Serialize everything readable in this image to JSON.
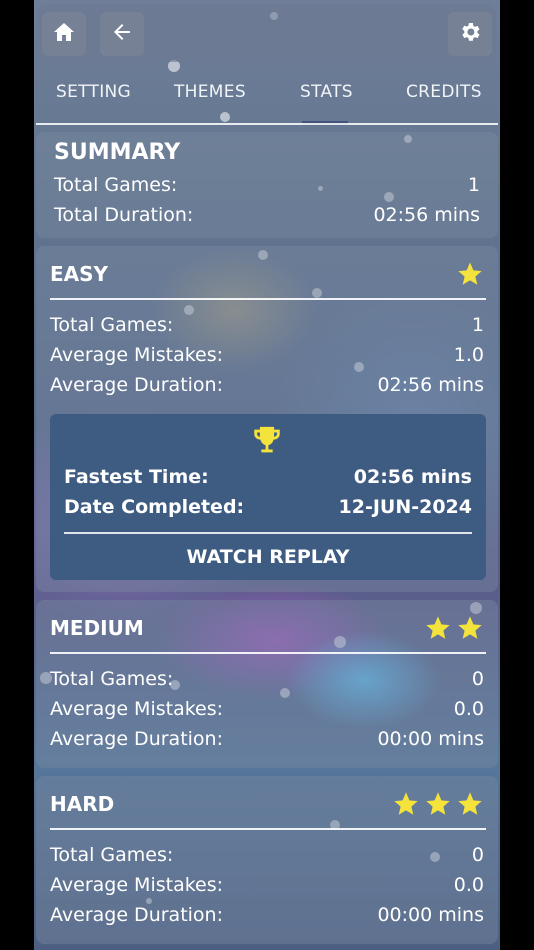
{
  "nav": {
    "home_icon": "home-icon",
    "back_icon": "back-arrow-icon",
    "settings_icon": "gear-icon"
  },
  "tabs": [
    {
      "label": "SETTINGS"
    },
    {
      "label": "THEMES"
    },
    {
      "label": "STATS",
      "active": true
    },
    {
      "label": "CREDITS"
    }
  ],
  "summary": {
    "title": "SUMMARY",
    "total_games_label": "Total Games:",
    "total_games_value": "1",
    "total_duration_label": "Total Duration:",
    "total_duration_value": "02:56 mins"
  },
  "easy": {
    "title": "EASY",
    "stars": 1,
    "total_games_label": "Total Games:",
    "total_games_value": "1",
    "avg_mistakes_label": "Average Mistakes:",
    "avg_mistakes_value": "1.0",
    "avg_duration_label": "Average Duration:",
    "avg_duration_value": "02:56 mins",
    "best": {
      "icon": "trophy-icon",
      "fastest_label": "Fastest Time:",
      "fastest_value": "02:56 mins",
      "date_label": "Date Completed:",
      "date_value": "12-JUN-2024",
      "replay_label": "WATCH REPLAY"
    }
  },
  "medium": {
    "title": "MEDIUM",
    "stars": 2,
    "total_games_label": "Total Games:",
    "total_games_value": "0",
    "avg_mistakes_label": "Average Mistakes:",
    "avg_mistakes_value": "0.0",
    "avg_duration_label": "Average Duration:",
    "avg_duration_value": "00:00 mins"
  },
  "hard": {
    "title": "HARD",
    "stars": 3,
    "total_games_label": "Total Games:",
    "total_games_value": "0",
    "avg_mistakes_label": "Average Mistakes:",
    "avg_mistakes_value": "0.0",
    "avg_duration_label": "Average Duration:",
    "avg_duration_value": "00:00 mins"
  },
  "colors": {
    "star": "#f4e23d",
    "trophy": "#f4e23d",
    "best_panel": "#3e5b82"
  }
}
